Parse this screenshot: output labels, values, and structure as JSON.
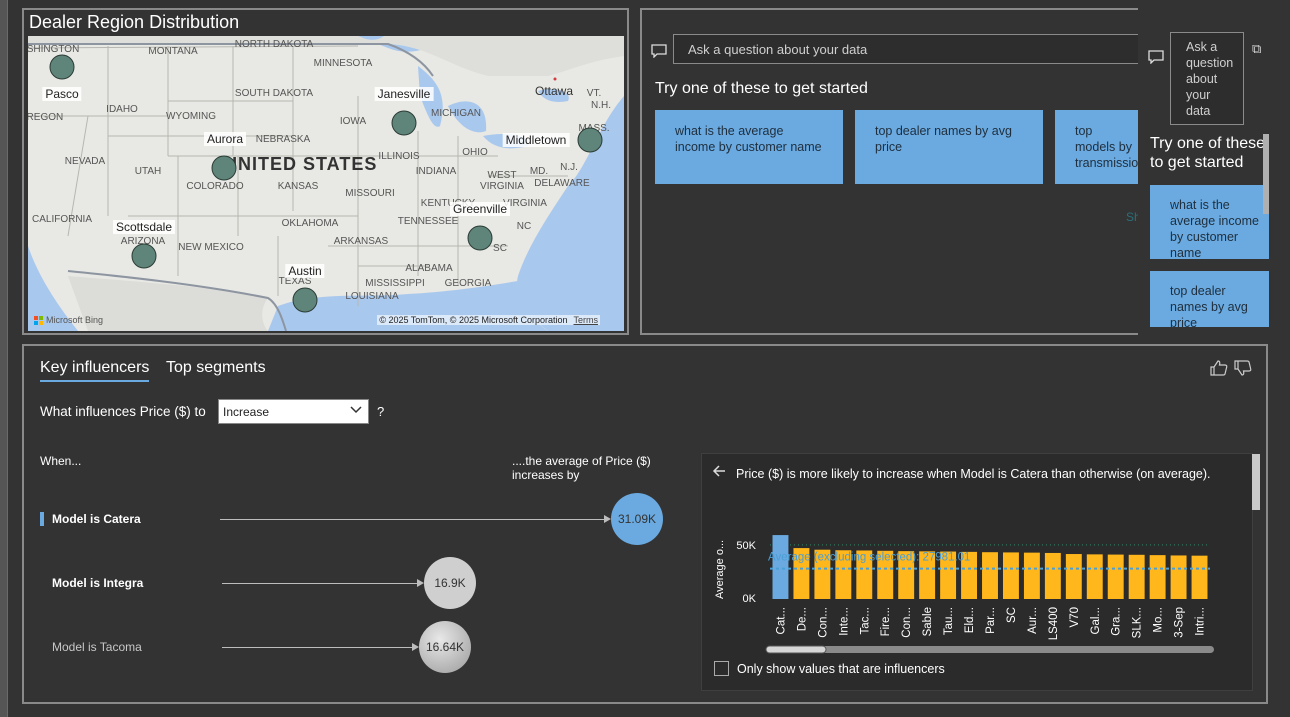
{
  "map": {
    "title": "Dealer Region Distribution",
    "country_label": "UNITED STATES",
    "cities": [
      {
        "name": "Pasco"
      },
      {
        "name": "Aurora"
      },
      {
        "name": "Janesville"
      },
      {
        "name": "Middletown"
      },
      {
        "name": "Scottsdale"
      },
      {
        "name": "Greenville"
      },
      {
        "name": "Austin"
      }
    ],
    "states": [
      "SHINGTON",
      "MONTANA",
      "NORTH DAKOTA",
      "MINNESOTA",
      "SOUTH DAKOTA",
      "IDAHO",
      "WYOMING",
      "IOWA",
      "NEBRASKA",
      "ILLINOIS",
      "OHIO",
      "NEVADA",
      "UTAH",
      "COLORADO",
      "KANSAS",
      "MISSOURI",
      "INDIANA",
      "WEST VIRGINIA",
      "CALIFORNIA",
      "OKLAHOMA",
      "TENNESSEE",
      "ARIZONA",
      "NEW MEXICO",
      "ARKANSAS",
      "NC",
      "SC",
      "ALABAMA",
      "MISSISSIPPI",
      "GEORGIA",
      "TEXAS",
      "LOUISIANA",
      "MICHIGAN",
      "Ottawa",
      "VT.",
      "N.H.",
      "MASS.",
      "MD.",
      "N.J.",
      "DELAWARE",
      "OREGON",
      "KENTUCKY",
      "VIRGINIA"
    ],
    "bing": "Microsoft Bing",
    "copyright": "© 2025 TomTom, © 2025 Microsoft Corporation",
    "terms": "Terms"
  },
  "qa": {
    "placeholder": "Ask a question about your data",
    "try_title": "Try one of these to get started",
    "suggestions": [
      "what is the average income by customer name",
      "top dealer names by avg price",
      "top models by transmission"
    ],
    "faded_text": "Sh",
    "side_input_placeholder": "Ask a question about your data",
    "side_try_title": "Try one of these to get started",
    "side_suggestions": [
      "what is the average income by customer name",
      "top dealer names by avg price"
    ]
  },
  "key_influencers": {
    "tabs": [
      "Key influencers",
      "Top segments"
    ],
    "question_prefix": "What influences Price ($) to",
    "selected_option": "Increase",
    "question_suffix": "?",
    "when_label": "When...",
    "avg_header": "....the average of Price ($) increases by",
    "influencers": [
      {
        "label": "Model is Catera",
        "value": "31.09K",
        "selected": true
      },
      {
        "label": "Model is Integra",
        "value": "16.9K",
        "selected": false
      },
      {
        "label": "Model is Tacoma",
        "value": "16.64K",
        "selected": false
      }
    ],
    "detail": {
      "title": "Price ($) is more likely to increase when Model is Catera than otherwise (on average).",
      "checkbox_label": "Only show values that are influencers"
    }
  },
  "chart_data": {
    "type": "bar",
    "ylabel": "Average o...",
    "ytick_labels": [
      "50K",
      "0K"
    ],
    "ylim": [
      0,
      60000
    ],
    "average_line_label": "Average (excluding selected): 27981.01",
    "average_line_value": 27981.01,
    "categories": [
      "Cat...",
      "De...",
      "Con...",
      "Inte...",
      "Tac...",
      "Fire...",
      "Con...",
      "Sable",
      "Tau...",
      "Eld...",
      "Par...",
      "SC",
      "Aur...",
      "LS400",
      "V70",
      "Gal...",
      "Gra...",
      "SLK...",
      "Mo...",
      "3-Sep",
      "Intri..."
    ],
    "values": [
      59000,
      47000,
      45500,
      45000,
      44800,
      44500,
      44200,
      44000,
      43800,
      43500,
      43200,
      43000,
      42800,
      42500,
      41500,
      41200,
      41000,
      40800,
      40500,
      40200,
      40000
    ],
    "highlight_index": 0,
    "colors": {
      "selected": "#6aaae0",
      "other": "#ffb71b",
      "average_line": "#4a9fd6"
    }
  }
}
